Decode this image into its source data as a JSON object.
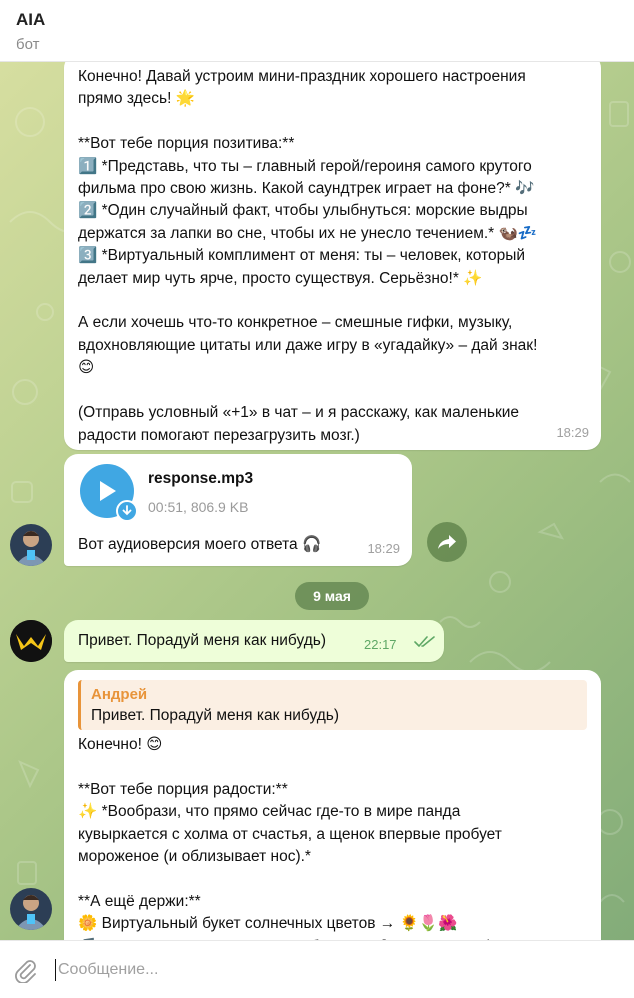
{
  "header": {
    "title": "AIA",
    "subtitle": "бот"
  },
  "messages": {
    "first": {
      "text": "Конечно! Давай устроим мини-праздник хорошего настроения\nпрямо здесь! 🌟\n\n**Вот тебе порция позитива:**\n1️⃣ *Представь, что ты – главный герой/героиня самого крутого\nфильма про свою жизнь. Какой саундтрек играет на фоне?* 🎶\n2️⃣ *Один случайный факт, чтобы улыбнуться: морские выдры\nдержатся за лапки во сне, чтобы их не унесло течением.* 🦦💤\n3️⃣ *Виртуальный комплимент от меня: ты – человек, который\nделает мир чуть ярче, просто существуя. Серьёзно!* ✨\n\nА если хочешь что-то конкретное – смешные гифки, музыку,\nвдохновляющие цитаты или даже игру в «угадайку» – дай знак!\n😊\n\n(Отправь условный «+1» в чат – и я расскажу, как маленькие\nрадости помогают перезагрузить мозг.)",
      "time": "18:29"
    },
    "audio": {
      "file_name": "response.mp3",
      "file_meta": "00:51, 806.9 KB",
      "caption": "Вот аудиоверсия моего ответа 🎧",
      "time": "18:29"
    },
    "date_separator": "9 мая",
    "outgoing": {
      "text": "Привет. Порадуй меня как нибудь)",
      "time": "22:17"
    },
    "reply": {
      "quote_author": "Андрей",
      "quote_text": "Привет. Порадуй меня как нибудь)",
      "text": "Конечно! 😊\n\n**Вот тебе порция радости:**\n✨ *Вообрази, что прямо сейчас где-то в мире панда\nкувыркается с холма от счастья, а щенок впервые пробует\nмороженое (и облизывает нос).*\n\n**А ещё держи:**\n🌼 Виртуальный букет солнечных цветов → 🌻🌷🌺\n🎵 Песня, которая заставит улыбнуться: *[„Here Comes the"
    }
  },
  "input": {
    "placeholder": "Сообщение..."
  },
  "colors": {
    "accent": "#40a7e3",
    "outgoing_bubble": "#eefed9",
    "quote_accent": "#e8943a",
    "date_pill": "#668a54"
  },
  "icons": {
    "audio_play": "play-icon",
    "audio_download": "download-icon",
    "share": "share-icon",
    "read_status": "double-check-icon",
    "attach": "paperclip-icon"
  }
}
